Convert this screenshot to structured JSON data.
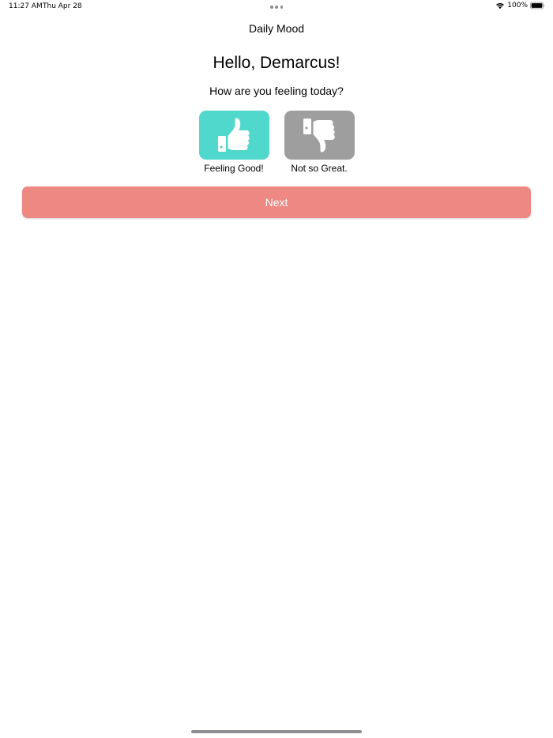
{
  "status_bar": {
    "time": "11:27 AM",
    "date": "Thu Apr 28",
    "battery_percent": "100%",
    "battery_level": 1.0,
    "wifi_icon": "wifi-icon",
    "battery_icon": "battery-icon"
  },
  "nav": {
    "title": "Daily Mood"
  },
  "greeting": "Hello, Demarcus!",
  "question": "How are you feeling today?",
  "moods": [
    {
      "label": "Feeling Good!",
      "icon": "thumbs-up-icon",
      "color": "#4fd8cb"
    },
    {
      "label": "Not so Great.",
      "icon": "thumbs-down-icon",
      "color": "#9e9e9e"
    }
  ],
  "next_button": {
    "label": "Next",
    "color": "#ee8883"
  }
}
